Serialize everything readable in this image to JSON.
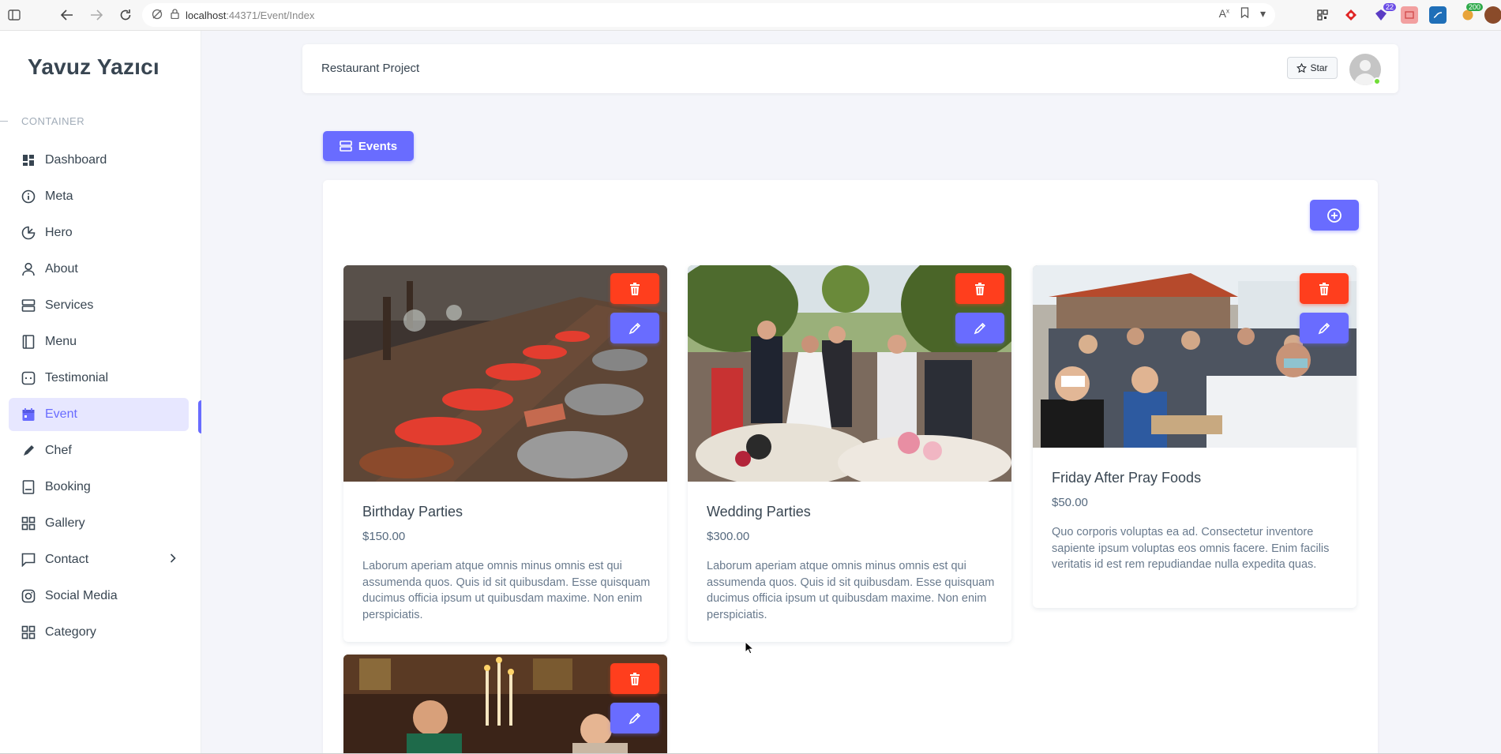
{
  "browser": {
    "url_host": "localhost",
    "url_path": ":44371/Event/Index",
    "ext_badge_1": "22",
    "ext_badge_2": "200"
  },
  "sidebar": {
    "brand": "Yavuz Yazıcı",
    "section_title": "CONTAINER",
    "items": [
      {
        "label": "Dashboard",
        "icon": "dashboard-icon"
      },
      {
        "label": "Meta",
        "icon": "info-icon"
      },
      {
        "label": "Hero",
        "icon": "pie-icon"
      },
      {
        "label": "About",
        "icon": "user-icon"
      },
      {
        "label": "Services",
        "icon": "server-icon"
      },
      {
        "label": "Menu",
        "icon": "book-icon"
      },
      {
        "label": "Testimonial",
        "icon": "chat-icon"
      },
      {
        "label": "Event",
        "icon": "calendar-icon",
        "active": true
      },
      {
        "label": "Chef",
        "icon": "pen-icon"
      },
      {
        "label": "Booking",
        "icon": "booking-icon"
      },
      {
        "label": "Gallery",
        "icon": "grid-icon"
      },
      {
        "label": "Contact",
        "icon": "message-icon",
        "has_submenu": true
      },
      {
        "label": "Social Media",
        "icon": "instagram-icon"
      },
      {
        "label": "Category",
        "icon": "category-icon"
      }
    ]
  },
  "navbar": {
    "project": "Restaurant Project",
    "star_label": "Star"
  },
  "tabs": {
    "events_label": "Events"
  },
  "events": [
    {
      "title": "Birthday Parties",
      "price": "$150.00",
      "description": "Laborum aperiam atque omnis minus omnis est qui assumenda quos. Quis id sit quibusdam. Esse quisquam ducimus officia ipsum ut quibusdam maxime. Non enim perspiciatis."
    },
    {
      "title": "Wedding Parties",
      "price": "$300.00",
      "description": "Laborum aperiam atque omnis minus omnis est qui assumenda quos. Quis id sit quibusdam. Esse quisquam ducimus officia ipsum ut quibusdam maxime. Non enim perspiciatis."
    },
    {
      "title": "Friday After Pray Foods",
      "price": "$50.00",
      "description": "Quo corporis voluptas ea ad. Consectetur inventore sapiente ipsum voluptas eos omnis facere. Enim facilis veritatis id est rem repudiandae nulla expedita quas."
    },
    {
      "title": "",
      "price": "",
      "description": ""
    }
  ],
  "colors": {
    "primary": "#696cff",
    "danger": "#ff3e1d",
    "sidebar_active_bg": "#e7e7ff",
    "page_bg": "#f4f5fa"
  }
}
